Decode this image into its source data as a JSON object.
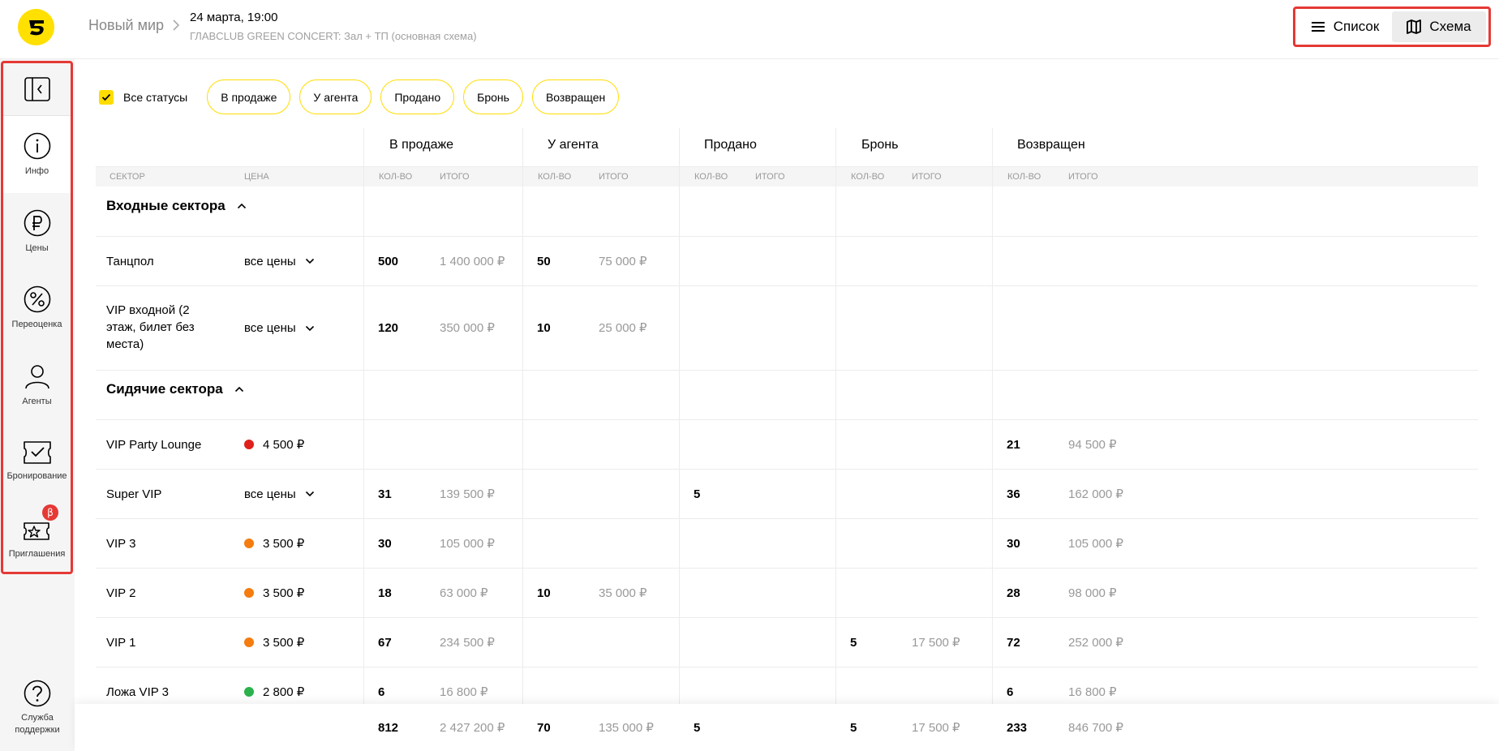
{
  "header": {
    "breadcrumb_root": "Новый мир",
    "event_date": "24 марта, 19:00",
    "event_subtitle": "ГЛАВCLUB GREEN CONCERT: Зал + ТП (основная схема)",
    "view_list": "Список",
    "view_scheme": "Схема",
    "active_view": "Схема"
  },
  "sidebar": {
    "items": [
      {
        "label": "Инфо",
        "icon": "info-icon"
      },
      {
        "label": "Цены",
        "icon": "ruble-icon"
      },
      {
        "label": "Переоценка",
        "icon": "percent-icon"
      },
      {
        "label": "Агенты",
        "icon": "person-icon"
      },
      {
        "label": "Бронирование",
        "icon": "ticket-check-icon"
      },
      {
        "label": "Приглашения",
        "icon": "invite-ticket-icon",
        "badge": "β"
      }
    ],
    "support_label_1": "Служба",
    "support_label_2": "поддержки"
  },
  "filters": {
    "all_label": "Все статусы",
    "all_checked": true,
    "chips": [
      "В продаже",
      "У агента",
      "Продано",
      "Бронь",
      "Возвращен"
    ]
  },
  "table": {
    "group_headers": [
      "В продаже",
      "У агента",
      "Продано",
      "Бронь",
      "Возвращен"
    ],
    "col_sector": "СЕКТОР",
    "col_price": "ЦЕНА",
    "col_qty": "КОЛ-ВО",
    "col_total": "ИТОГО",
    "sections": [
      {
        "title": "Входные сектора",
        "rows": [
          {
            "name": "Танцпол",
            "price": "все цены",
            "dot": "",
            "cells": [
              [
                "500",
                "1 400 000 ₽"
              ],
              [
                "50",
                "75 000 ₽"
              ],
              [
                "",
                ""
              ],
              [
                "",
                ""
              ],
              [
                "",
                ""
              ]
            ]
          },
          {
            "name": "VIP входной (2 этаж, билет без места)",
            "price": "все цены",
            "dot": "",
            "cells": [
              [
                "120",
                "350 000 ₽"
              ],
              [
                "10",
                "25 000 ₽"
              ],
              [
                "",
                ""
              ],
              [
                "",
                ""
              ],
              [
                "",
                ""
              ]
            ]
          }
        ]
      },
      {
        "title": "Сидячие сектора",
        "rows": [
          {
            "name": "VIP Party Lounge",
            "price": "4 500 ₽",
            "dot": "#e0201b",
            "cells": [
              [
                "",
                ""
              ],
              [
                "",
                ""
              ],
              [
                "",
                ""
              ],
              [
                "",
                ""
              ],
              [
                "21",
                "94 500 ₽"
              ]
            ]
          },
          {
            "name": "Super VIP",
            "price": "все цены",
            "dot": "",
            "cells": [
              [
                "31",
                "139 500 ₽"
              ],
              [
                "",
                ""
              ],
              [
                "5",
                ""
              ],
              [
                "",
                ""
              ],
              [
                "36",
                "162 000 ₽"
              ]
            ]
          },
          {
            "name": "VIP 3",
            "price": "3 500 ₽",
            "dot": "#f57c0f",
            "cells": [
              [
                "30",
                "105 000 ₽"
              ],
              [
                "",
                ""
              ],
              [
                "",
                ""
              ],
              [
                "",
                ""
              ],
              [
                "30",
                "105 000 ₽"
              ]
            ]
          },
          {
            "name": "VIP 2",
            "price": "3 500 ₽",
            "dot": "#f57c0f",
            "cells": [
              [
                "18",
                "63 000 ₽"
              ],
              [
                "10",
                "35 000 ₽"
              ],
              [
                "",
                ""
              ],
              [
                "",
                ""
              ],
              [
                "28",
                "98 000 ₽"
              ]
            ]
          },
          {
            "name": "VIP 1",
            "price": "3 500 ₽",
            "dot": "#f57c0f",
            "cells": [
              [
                "67",
                "234 500 ₽"
              ],
              [
                "",
                ""
              ],
              [
                "",
                ""
              ],
              [
                "5",
                "17 500 ₽"
              ],
              [
                "72",
                "252 000 ₽"
              ]
            ]
          },
          {
            "name": "Ложа VIP 3",
            "price": "2 800 ₽",
            "dot": "#2bb24c",
            "cells": [
              [
                "6",
                "16 800 ₽"
              ],
              [
                "",
                ""
              ],
              [
                "",
                ""
              ],
              [
                "",
                ""
              ],
              [
                "6",
                "16 800 ₽"
              ]
            ]
          }
        ]
      }
    ],
    "totals": [
      [
        "812",
        "2 427 200 ₽"
      ],
      [
        "70",
        "135 000 ₽"
      ],
      [
        "5",
        ""
      ],
      [
        "5",
        "17 500 ₽"
      ],
      [
        "233",
        "846 700 ₽"
      ]
    ]
  }
}
